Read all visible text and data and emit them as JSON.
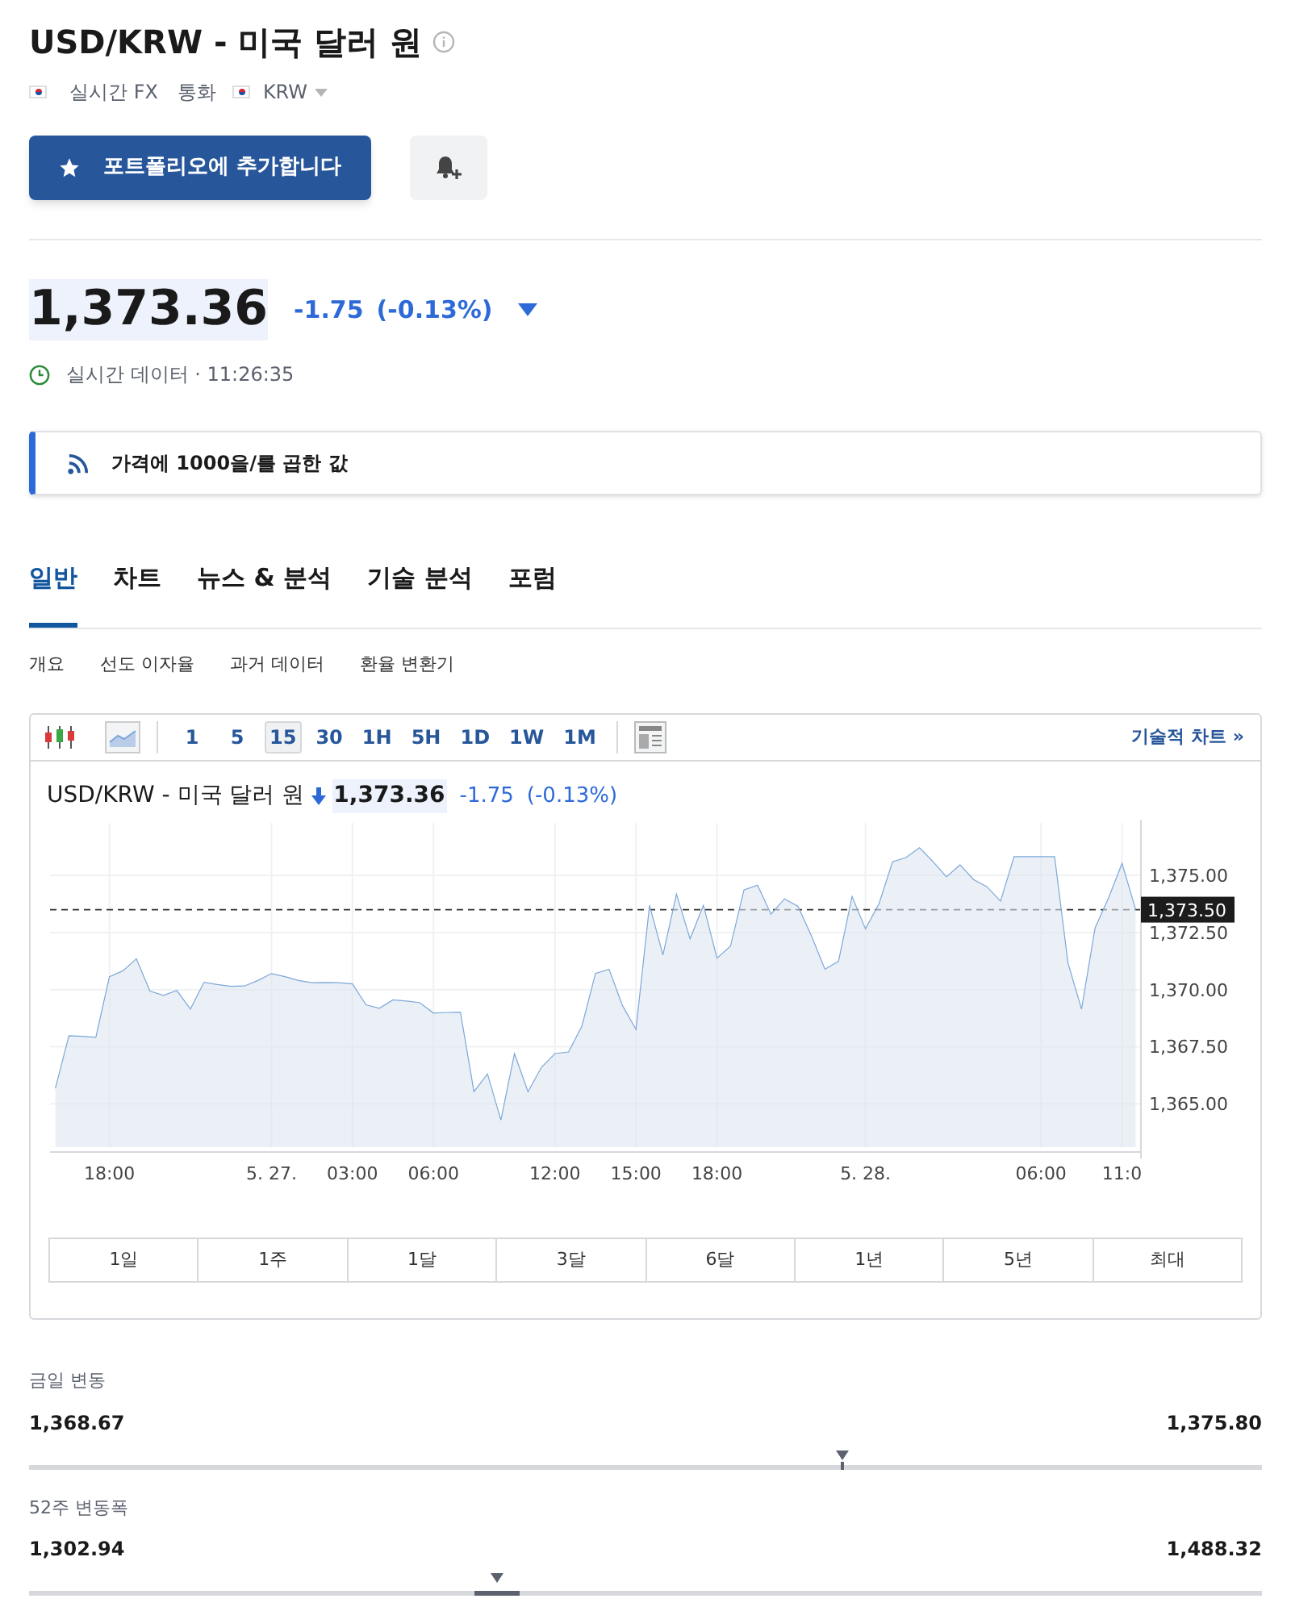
{
  "title": "USD/KRW - 미국 달러 원",
  "meta": {
    "market": "실시간 FX",
    "type": "통화",
    "currency": "KRW"
  },
  "portfolio_button": "포트폴리오에 추가합니다",
  "quote": {
    "price": "1,373.36",
    "change": "-1.75",
    "change_pct": "(-0.13%)",
    "status": "실시간 데이터 · 11:26:35"
  },
  "notice": "가격에 1000을/를 곱한 값",
  "tabs": [
    {
      "label": "일반",
      "selected": true
    },
    {
      "label": "차트",
      "selected": false
    },
    {
      "label": "뉴스 & 분석",
      "selected": false
    },
    {
      "label": "기술 분석",
      "selected": false
    },
    {
      "label": "포럼",
      "selected": false
    }
  ],
  "subtabs": [
    "개요",
    "선도 이자율",
    "과거 데이터",
    "환율 변환기"
  ],
  "chart_panel": {
    "intervals": [
      {
        "label": "1",
        "selected": false
      },
      {
        "label": "5",
        "selected": false
      },
      {
        "label": "15",
        "selected": true
      },
      {
        "label": "30",
        "selected": false
      },
      {
        "label": "1H",
        "selected": false
      },
      {
        "label": "5H",
        "selected": false
      },
      {
        "label": "1D",
        "selected": false
      },
      {
        "label": "1W",
        "selected": false
      },
      {
        "label": "1M",
        "selected": false
      }
    ],
    "technical_link": "기술적 차트 »",
    "legend": {
      "name": "USD/KRW - 미국 달러 원",
      "price": "1,373.36",
      "change": "-1.75",
      "change_pct": "(-0.13%)"
    },
    "chart_data": {
      "type": "area",
      "categories": [
        null,
        null,
        null,
        null,
        "18:00",
        null,
        null,
        null,
        null,
        null,
        null,
        null,
        null,
        null,
        null,
        null,
        "5. 27.",
        null,
        null,
        null,
        null,
        null,
        "03:00",
        null,
        null,
        null,
        null,
        null,
        "06:00",
        null,
        null,
        null,
        null,
        null,
        null,
        null,
        null,
        "12:00",
        null,
        null,
        null,
        null,
        null,
        "15:00",
        null,
        null,
        null,
        null,
        null,
        "18:00",
        null,
        null,
        null,
        null,
        null,
        null,
        null,
        null,
        null,
        null,
        "5. 28.",
        null,
        null,
        null,
        null,
        null,
        null,
        null,
        null,
        null,
        null,
        null,
        null,
        "06:00",
        null,
        null,
        null,
        null,
        null,
        "11:0",
        null
      ],
      "series": [
        {
          "color": "#7ba7d9",
          "values": [
            1365.67,
            1367.98,
            1367.95,
            1367.91,
            1370.57,
            1370.82,
            1371.35,
            1369.93,
            1369.75,
            1369.96,
            1369.15,
            1370.32,
            1370.22,
            1370.14,
            1370.16,
            1370.4,
            1370.7,
            1370.57,
            1370.4,
            1370.3,
            1370.31,
            1370.3,
            1370.25,
            1369.33,
            1369.18,
            1369.55,
            1369.5,
            1369.42,
            1368.97,
            1369.0,
            1369.01,
            1365.53,
            1366.31,
            1364.29,
            1367.2,
            1365.53,
            1366.6,
            1367.2,
            1367.27,
            1368.4,
            1370.71,
            1370.89,
            1369.3,
            1368.26,
            1373.69,
            1371.52,
            1374.18,
            1372.23,
            1373.69,
            1371.38,
            1371.9,
            1374.36,
            1374.57,
            1373.3,
            1373.97,
            1373.65,
            1372.34,
            1370.89,
            1371.24,
            1374.08,
            1372.66,
            1373.76,
            1375.6,
            1375.78,
            1376.21,
            1375.6,
            1374.93,
            1375.46,
            1374.82,
            1374.5,
            1373.87,
            1375.82,
            1375.82,
            1375.82,
            1375.82,
            1371.17,
            1369.15,
            1372.7,
            1374.01,
            1375.53,
            1373.51
          ]
        }
      ],
      "ylim": [
        1363.1,
        1377.3
      ],
      "yticks": [
        {
          "value": 1365,
          "label": "1,365.00"
        },
        {
          "value": 1367.5,
          "label": "1,367.50"
        },
        {
          "value": 1370,
          "label": "1,370.00"
        },
        {
          "value": 1372.5,
          "label": "1,372.50"
        },
        {
          "value": 1375,
          "label": "1,375.00"
        }
      ],
      "grid": true,
      "ref_lines": [
        {
          "axis": "y",
          "value": 1373.5,
          "label": "1,373.50"
        }
      ]
    },
    "ranges": [
      {
        "label": "1일",
        "selected": false
      },
      {
        "label": "1주",
        "selected": false
      },
      {
        "label": "1달",
        "selected": false
      },
      {
        "label": "3달",
        "selected": false
      },
      {
        "label": "6달",
        "selected": false
      },
      {
        "label": "1년",
        "selected": false
      },
      {
        "label": "5년",
        "selected": false
      },
      {
        "label": "최대",
        "selected": false
      }
    ]
  },
  "range_stats": [
    {
      "label": "금일 변동",
      "low": "1,368.67",
      "high": "1,375.80",
      "level": 0.66,
      "kind": "tick"
    },
    {
      "label": "52주 변동폭",
      "low": "1,302.94",
      "high": "1,488.32",
      "level": 0.38,
      "kind": "bar"
    }
  ]
}
